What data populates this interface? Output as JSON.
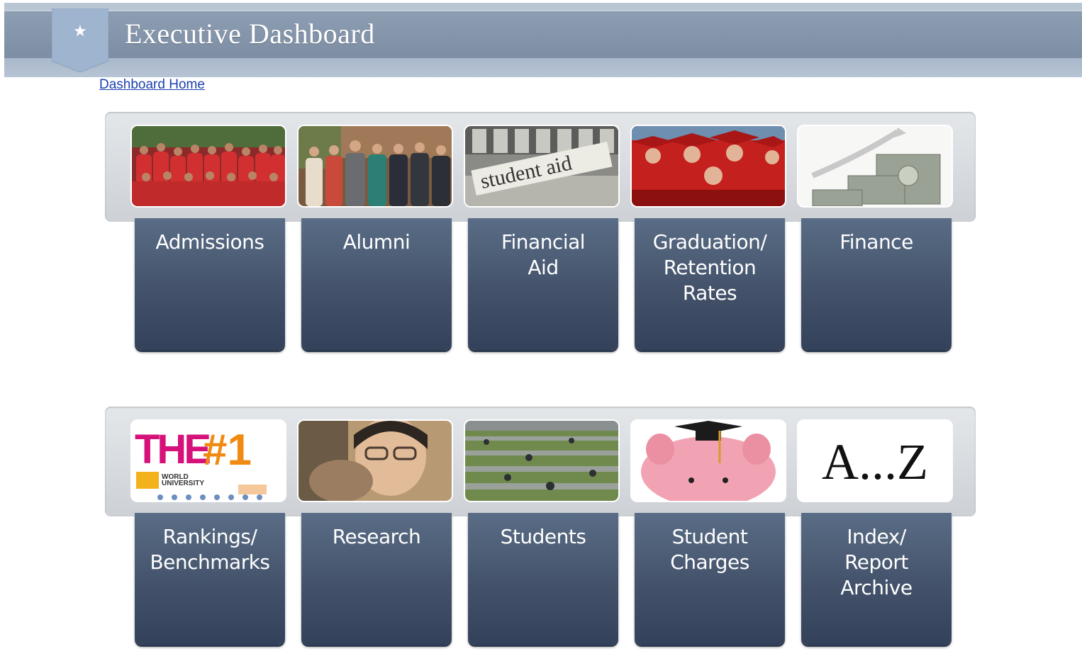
{
  "header": {
    "title": "Executive Dashboard",
    "star_glyph": "★",
    "band_color": "#8696ab"
  },
  "nav": {
    "home_link": "Dashboard Home"
  },
  "tiles_row1": [
    {
      "label": "Admissions",
      "image": "students-group-photo"
    },
    {
      "label": "Alumni",
      "image": "alumni-group-photo"
    },
    {
      "label": "Financial\nAid",
      "image": "student-aid-money-photo"
    },
    {
      "label": "Graduation/\nRetention\nRates",
      "image": "graduates-red-gowns-photo"
    },
    {
      "label": "Finance",
      "image": "dollar-bills-chart-photo"
    }
  ],
  "tiles_row2": [
    {
      "label": "Rankings/\nBenchmarks",
      "image": "rankings-logo",
      "logo_text": "THE #1",
      "logo_sub": "WORLD UNIVERSITY RANKINGS"
    },
    {
      "label": "Research",
      "image": "researcher-photo"
    },
    {
      "label": "Students",
      "image": "campus-lawn-photo"
    },
    {
      "label": "Student\nCharges",
      "image": "piggy-bank-graduation-cap-photo"
    },
    {
      "label": "Index/\nReport\nArchive",
      "image": "a-to-z-index",
      "index_text": "A...Z"
    }
  ]
}
